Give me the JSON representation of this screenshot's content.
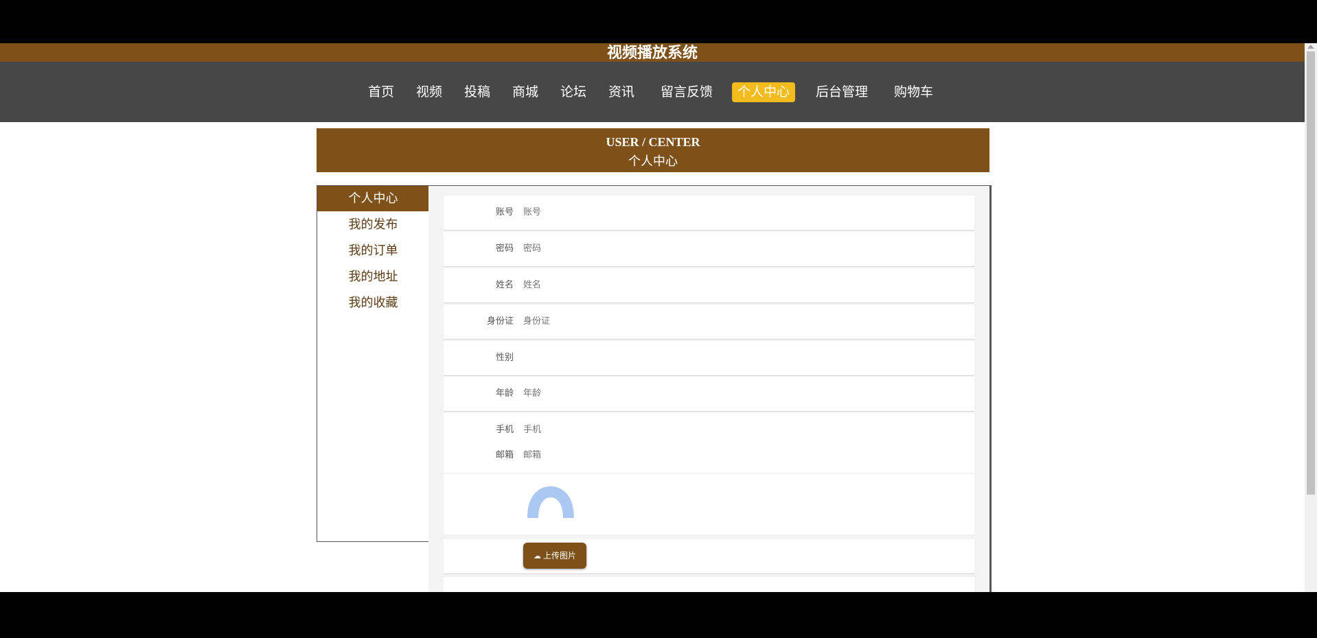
{
  "app": {
    "title": "视频播放系统"
  },
  "nav": {
    "items": [
      "首页",
      "视频",
      "投稿",
      "商城",
      "论坛",
      "资讯",
      "留言反馈",
      "个人中心",
      "后台管理",
      "购物车"
    ],
    "active_index": 7
  },
  "banner": {
    "en": "USER / CENTER",
    "cn": "个人中心"
  },
  "sidebar": {
    "items": [
      "个人中心",
      "我的发布",
      "我的订单",
      "我的地址",
      "我的收藏"
    ],
    "active_index": 0
  },
  "form": {
    "fields": [
      {
        "label": "账号",
        "placeholder": "账号"
      },
      {
        "label": "密码",
        "placeholder": "密码"
      },
      {
        "label": "姓名",
        "placeholder": "姓名"
      },
      {
        "label": "身份证",
        "placeholder": "身份证"
      },
      {
        "label": "性别",
        "placeholder": ""
      },
      {
        "label": "年龄",
        "placeholder": "年龄"
      },
      {
        "label": "手机",
        "placeholder": "手机"
      },
      {
        "label": "邮箱",
        "placeholder": "邮箱"
      }
    ],
    "upload_label": "上传图片"
  },
  "colors": {
    "brand": "#7d5119",
    "nav_bg": "#474747",
    "active": "#f3bb1c"
  }
}
